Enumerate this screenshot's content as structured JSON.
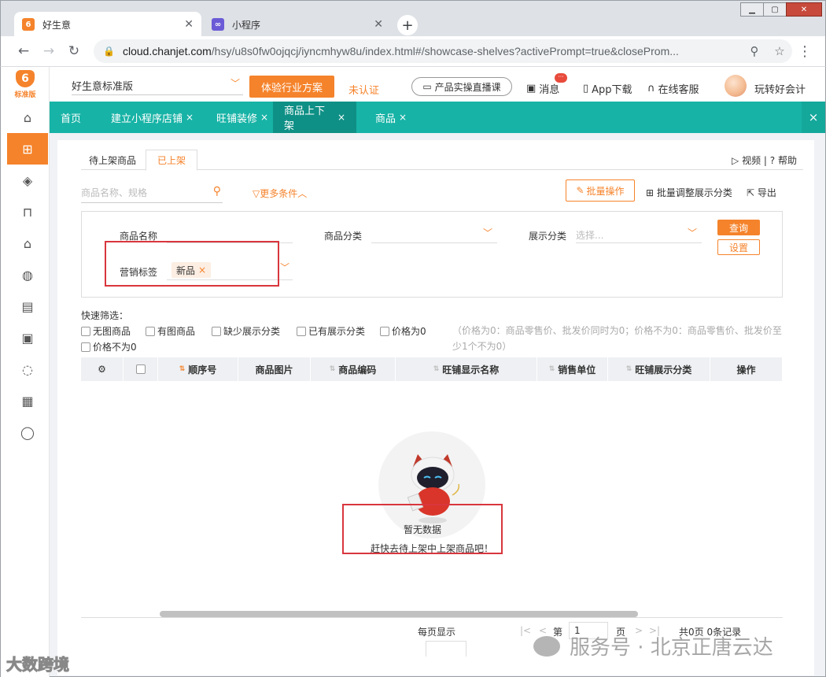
{
  "browser": {
    "tabs": [
      {
        "title": "好生意",
        "icon": "hao-shengyi-favicon",
        "color": "#f5832b"
      },
      {
        "title": "小程序",
        "icon": "mini-program-favicon",
        "color": "#6b5bd6"
      }
    ],
    "url_host": "cloud.chanjet.com",
    "url_path": "/hsy/u8s0fw0ojqcj/iyncmhyw8u/index.html#/showcase-shelves?activePrompt=true&closeProm..."
  },
  "sidebar": {
    "edition": "标准版",
    "items": [
      {
        "icon": "home-icon",
        "glyph": "⌂"
      },
      {
        "icon": "gift-icon",
        "glyph": "⬒",
        "active": true
      },
      {
        "icon": "tag-icon",
        "glyph": "◈"
      },
      {
        "icon": "bag-icon",
        "glyph": "▭"
      },
      {
        "icon": "warehouse-icon",
        "glyph": "⌂"
      },
      {
        "icon": "money-bag-icon",
        "glyph": "◍"
      },
      {
        "icon": "clipboard-icon",
        "glyph": "▤"
      },
      {
        "icon": "id-card-icon",
        "glyph": "▣"
      },
      {
        "icon": "cycle-icon",
        "glyph": "◌"
      },
      {
        "icon": "news-icon",
        "glyph": "▦"
      },
      {
        "icon": "chat-icon",
        "glyph": "◯"
      }
    ]
  },
  "topbar": {
    "version": "好生意标准版",
    "trial_button": "体验行业方案",
    "unverified": "未认证",
    "live_course": "产品实操直播课",
    "messages": "消息",
    "app_download": "App下载",
    "online_service": "在线客服",
    "user": "玩转好会计"
  },
  "nav": {
    "tabs": [
      {
        "label": "首页",
        "closable": false,
        "active": false
      },
      {
        "label": "建立小程序店铺",
        "closable": true,
        "active": false
      },
      {
        "label": "旺铺装修",
        "closable": true,
        "active": false
      },
      {
        "label": "商品上下架",
        "closable": true,
        "active": true
      },
      {
        "label": "商品",
        "closable": true,
        "active": false
      }
    ],
    "close_x": "×"
  },
  "panel": {
    "subtabs": [
      "待上架商品",
      "已上架"
    ],
    "video": "视频",
    "help": "帮助",
    "search_placeholder": "商品名称、规格",
    "more_conditions": "更多条件",
    "batch_ops": "批量操作",
    "batch_adjust": "批量调整展示分类",
    "export": "导出",
    "filters": {
      "product_name_label": "商品名称",
      "category_label": "商品分类",
      "display_category_label": "展示分类",
      "display_category_placeholder": "选择...",
      "marketing_tag_label": "营销标签",
      "marketing_tag_value": "新品",
      "query": "查询",
      "settings": "设置"
    },
    "quick_filter_title": "快速筛选：",
    "quick_filters": [
      "无图商品",
      "有图商品",
      "缺少展示分类",
      "已有展示分类",
      "价格为0",
      "价格不为0"
    ],
    "price_note": "（价格为0：商品零售价、批发价同时为0；价格不为0：商品零售价、批发价至少1个不为0）",
    "columns": [
      "顺序号",
      "商品图片",
      "商品编码",
      "旺铺显示名称",
      "销售单位",
      "旺铺展示分类",
      "操作"
    ],
    "empty_title": "暂无数据",
    "empty_subtitle": "赶快去待上架中上架商品吧！",
    "pager": {
      "per_page": "每页显示",
      "page_prefix": "第",
      "page_value": "1",
      "page_suffix": "页",
      "total": "共0页 0条记录"
    }
  },
  "watermarks": {
    "left": "大数跨境",
    "right": "服务号 · 北京正唐云达"
  },
  "colors": {
    "accent": "#f5832b",
    "nav_teal": "#17b3a6",
    "highlight_red": "#d9363e"
  }
}
